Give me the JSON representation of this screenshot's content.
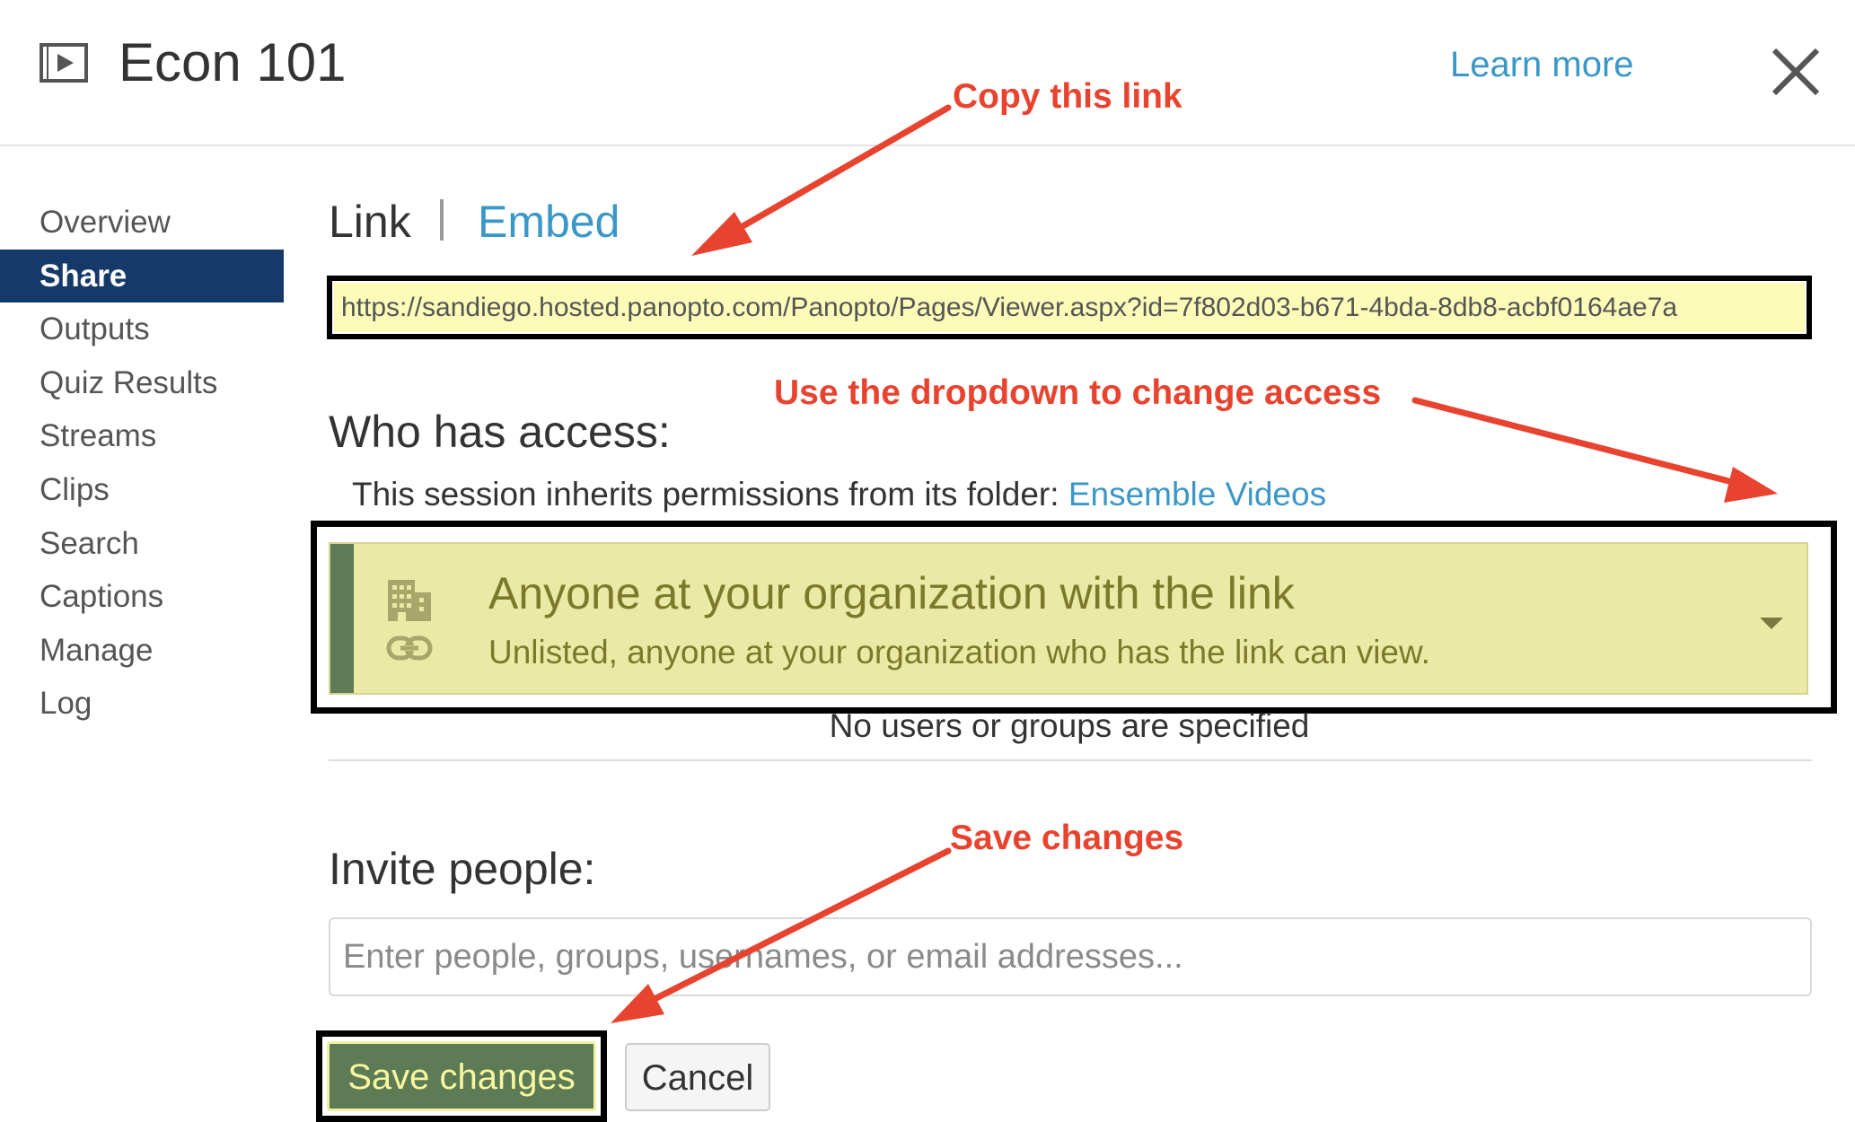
{
  "header": {
    "title": "Econ 101",
    "learn_more": "Learn more",
    "video_icon": "play-video-icon",
    "close_icon": "close-icon"
  },
  "sidebar": {
    "items": [
      {
        "label": "Overview"
      },
      {
        "label": "Share",
        "active": true
      },
      {
        "label": "Outputs"
      },
      {
        "label": "Quiz Results"
      },
      {
        "label": "Streams"
      },
      {
        "label": "Clips"
      },
      {
        "label": "Search"
      },
      {
        "label": "Captions"
      },
      {
        "label": "Manage"
      },
      {
        "label": "Log"
      }
    ]
  },
  "tabs": {
    "link": "Link",
    "embed": "Embed"
  },
  "link_field": {
    "value": "https://sandiego.hosted.panopto.com/Panopto/Pages/Viewer.aspx?id=7f802d03-b671-4bda-8db8-acbf0164ae7a"
  },
  "access": {
    "heading": "Who has access:",
    "inherit_prefix": "This session inherits permissions from its folder: ",
    "inherit_folder": "Ensemble Videos",
    "selected_title": "Anyone at your organization with the link",
    "selected_desc": "Unlisted, anyone at your organization who has the link can view.",
    "no_users": "No users or groups are specified"
  },
  "invite": {
    "heading": "Invite people:",
    "placeholder": "Enter people, groups, usernames, or email addresses..."
  },
  "buttons": {
    "save": "Save changes",
    "cancel": "Cancel"
  },
  "annotations": {
    "copy_link": "Copy this link",
    "dropdown": "Use the dropdown to change access",
    "save": "Save changes"
  },
  "colors": {
    "accent_link": "#3a97c8",
    "sidebar_active": "#153968",
    "annotation": "#e8432e",
    "highlight": "#fcfbb8",
    "save_button": "#5d7b54"
  }
}
